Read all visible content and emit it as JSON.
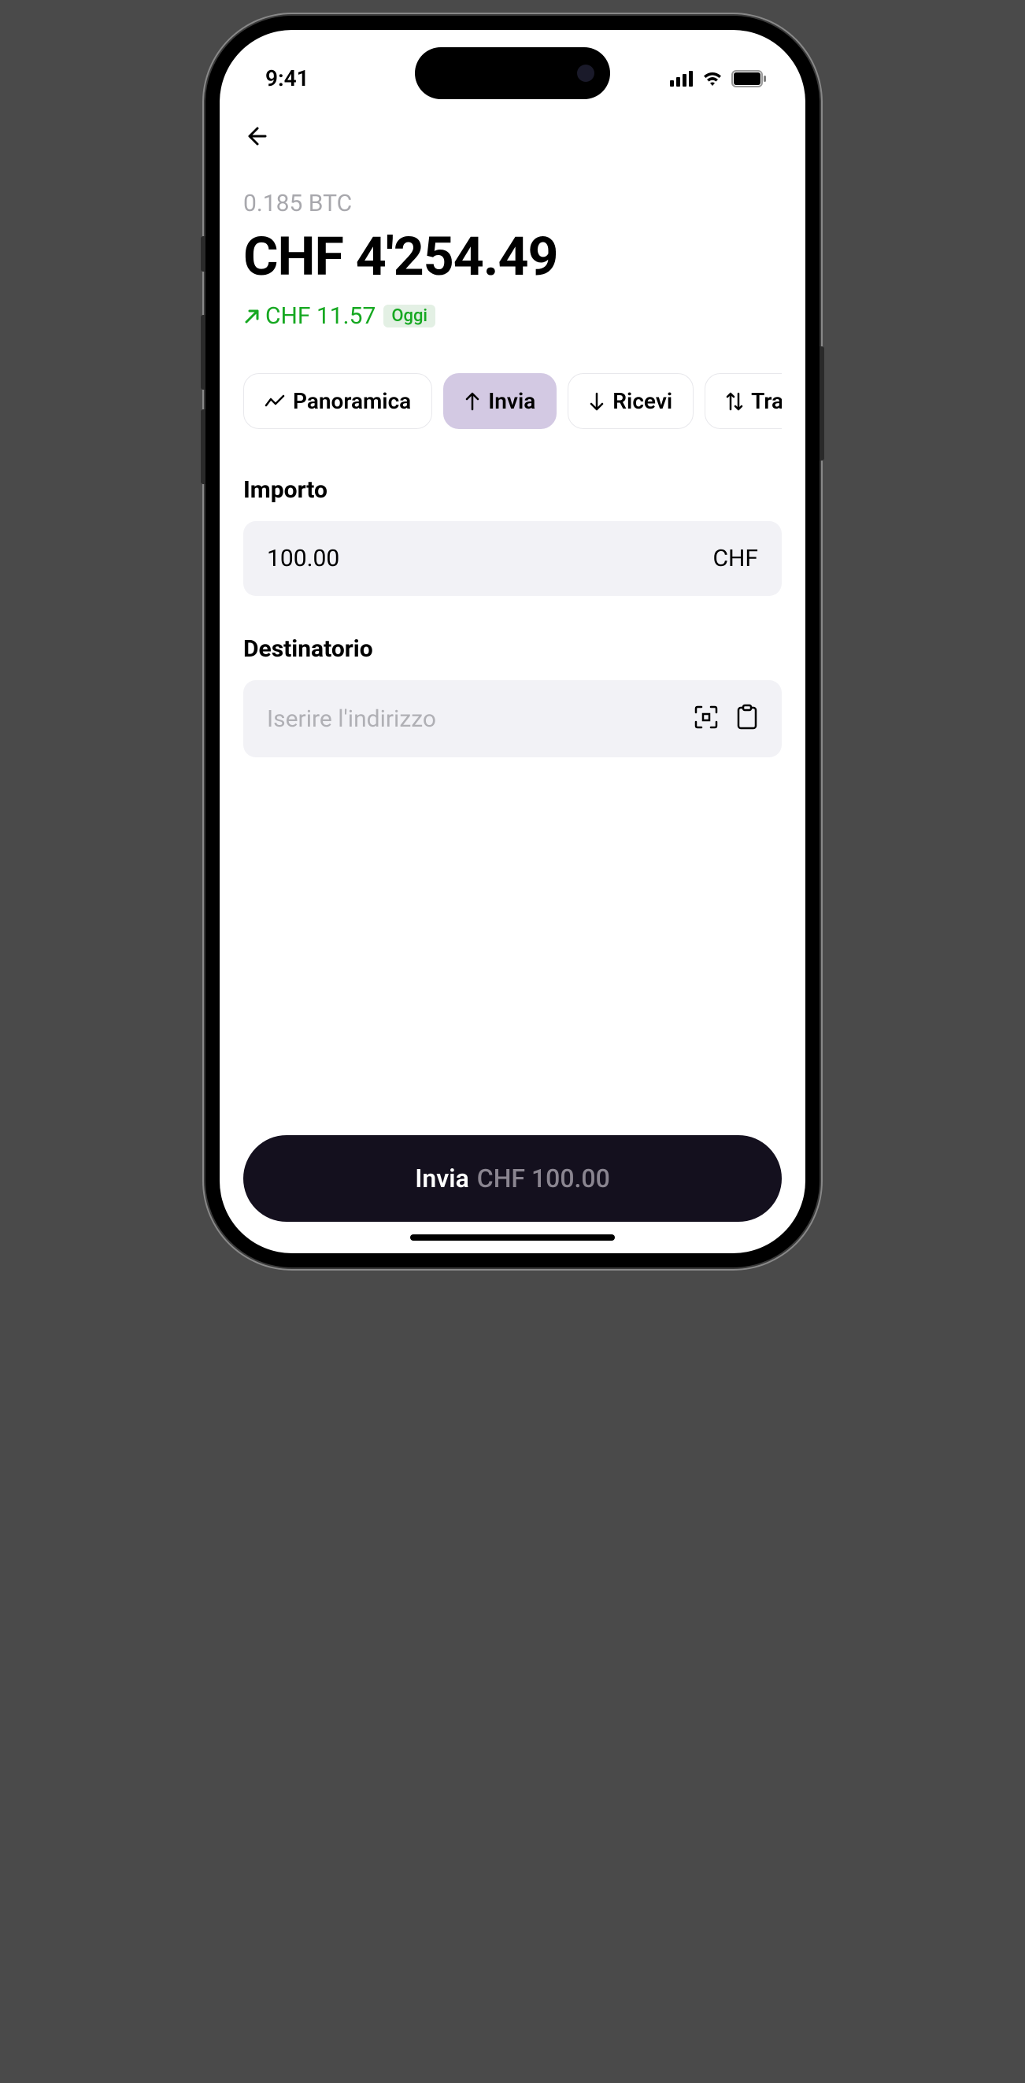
{
  "status": {
    "time": "9:41"
  },
  "balance": {
    "crypto": "0.185 BTC",
    "fiat": "CHF 4'254.49",
    "change_value": "CHF 11.57",
    "change_period": "Oggi"
  },
  "tabs": [
    {
      "label": "Panoramica"
    },
    {
      "label": "Invia"
    },
    {
      "label": "Ricevi"
    },
    {
      "label": "Transa"
    }
  ],
  "form": {
    "amount_label": "Importo",
    "amount_value": "100.00",
    "amount_currency": "CHF",
    "recipient_label": "Destinatorio",
    "recipient_placeholder": "Iserire l'indirizzo"
  },
  "send_button": {
    "label": "Invia",
    "amount": "CHF 100.00"
  }
}
